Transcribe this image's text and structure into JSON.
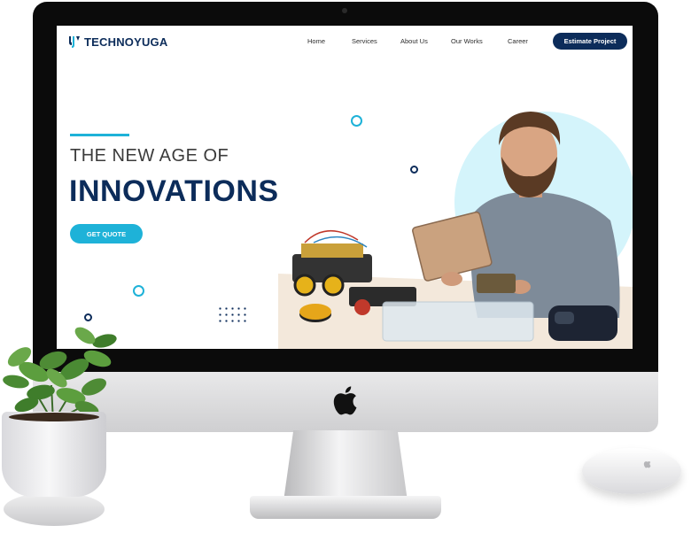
{
  "logo": {
    "text": "TECHNOYUGA"
  },
  "nav": {
    "items": [
      {
        "label": "Home"
      },
      {
        "label": "Services"
      },
      {
        "label": "About Us"
      },
      {
        "label": "Our Works"
      },
      {
        "label": "Career"
      }
    ],
    "cta_label": "Estimate Project"
  },
  "hero": {
    "line1": "THE NEW AGE OF",
    "line2": "INNOVATIONS",
    "button_label": "GET QUOTE"
  },
  "colors": {
    "navy": "#0c2c5a",
    "cyan": "#1eb2d8",
    "circle_bg": "#d4f4fb"
  },
  "icons": [
    "apple-logo-icon",
    "technoyuga-logo-icon"
  ]
}
